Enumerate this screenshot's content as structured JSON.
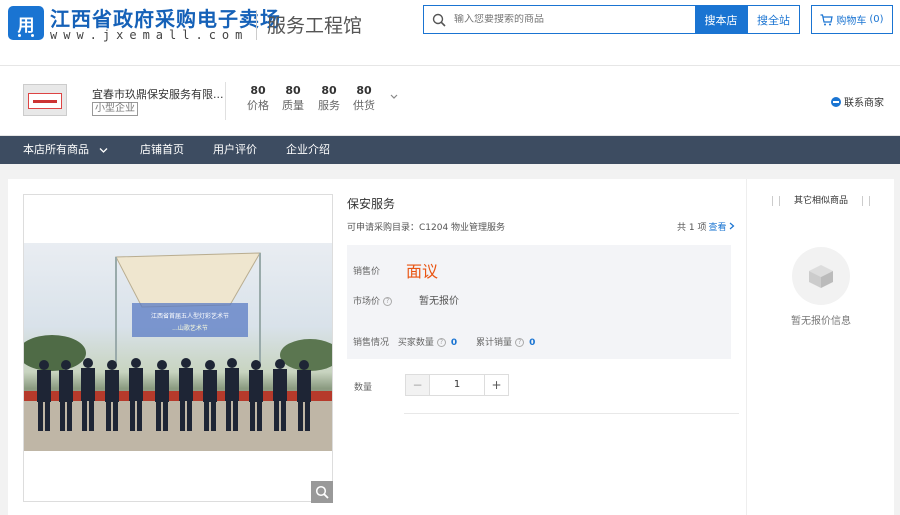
{
  "header": {
    "logo_glyph": "用",
    "site_title": "江西省政府采购电子卖场",
    "site_url": "www.jxemall.com",
    "section_name": "服务工程馆",
    "search_placeholder": "输入您要搜索的商品",
    "search_store_label": "搜本店",
    "search_all_label": "搜全站",
    "cart_label": "购物车",
    "cart_count": "(0)"
  },
  "store": {
    "name": "宜春市玖鼎保安服务有限...",
    "tag": "小型企业",
    "scores": [
      {
        "value": "80",
        "label": "价格"
      },
      {
        "value": "80",
        "label": "质量"
      },
      {
        "value": "80",
        "label": "服务"
      },
      {
        "value": "80",
        "label": "供货"
      }
    ],
    "contact_label": "联系商家"
  },
  "nav": {
    "items": [
      "本店所有商品",
      "店铺首页",
      "用户评价",
      "企业介绍"
    ]
  },
  "product": {
    "title": "保安服务",
    "catalog": "可申请采购目录：C1204 物业管理服务",
    "catalog_count": "共 1 项",
    "catalog_view": "查看",
    "price_label": "销售价",
    "price_value": "面议",
    "market_label": "市场价",
    "market_value": "暂无报价",
    "sales_label": "销售情况",
    "buyers_label": "买家数量",
    "buyers_value": "0",
    "cumulative_label": "累计销量",
    "cumulative_value": "0",
    "qty_label": "数量",
    "qty_minus": "−",
    "qty_value": "1",
    "qty_plus": "+",
    "photo_sign_line1": "江西省首届五人型灯彩艺术节",
    "photo_sign_line2": "...山歌艺术节"
  },
  "sidebar": {
    "title": "其它相似商品",
    "empty_text": "暂无报价信息"
  },
  "colors": {
    "brand_blue": "#1a74d2",
    "nav_bg": "#3d4c61",
    "price_orange": "#e95513"
  }
}
